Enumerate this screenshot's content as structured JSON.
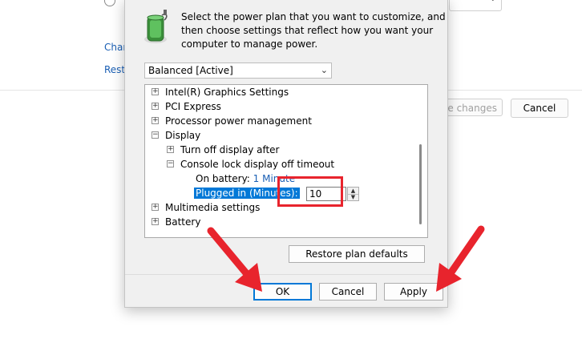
{
  "background": {
    "link_change": "Char",
    "link_restore": "Resto",
    "save_button": "e changes",
    "cancel_button": "Cancel"
  },
  "dialog": {
    "instructions": [
      "Select the power plan that you want to customize, and",
      "then choose settings that reflect how you want your",
      "computer to manage power."
    ],
    "plan_select": {
      "value": "Balanced [Active]"
    },
    "tree": [
      {
        "label": "Intel(R) Graphics Settings",
        "expander": "+"
      },
      {
        "label": "PCI Express",
        "expander": "+"
      },
      {
        "label": "Processor power management",
        "expander": "+"
      },
      {
        "label": "Display",
        "expander": "−"
      },
      {
        "label": "Turn off display after",
        "expander": "+"
      },
      {
        "label": "Console lock display off timeout",
        "expander": "−"
      },
      {
        "label": "On battery:",
        "value": "1 Minute"
      },
      {
        "label": "Plugged in (Minutes):",
        "value": "10"
      },
      {
        "label": "Multimedia settings",
        "expander": "+"
      },
      {
        "label": "Battery",
        "expander": "+"
      }
    ],
    "restore_defaults": "Restore plan defaults",
    "ok": "OK",
    "cancel": "Cancel",
    "apply": "Apply"
  },
  "colors": {
    "selection": "#0078d7",
    "highlight": "#e8242d",
    "arrow": "#e8242d",
    "link": "#1a5fb4"
  },
  "icons": {
    "plan_icon": "battery-power-plan-icon",
    "expander": "tree-expander-icon",
    "dropdown": "chevron-down-icon",
    "spin": "spin-arrows-icon",
    "annotation": "red-arrow-icon"
  }
}
